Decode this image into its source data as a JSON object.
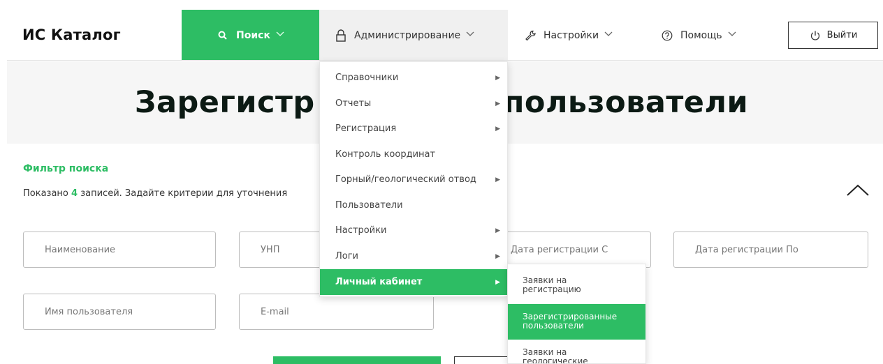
{
  "header": {
    "logo": "ИС Каталог",
    "nav": {
      "search": "Поиск",
      "admin": "Администрирование",
      "settings": "Настройки",
      "help": "Помощь"
    },
    "logout": "Выйти"
  },
  "page": {
    "title_left": "Зарегистр",
    "title_right": "пользователи"
  },
  "filter": {
    "title": "Фильтр поиска",
    "info_prefix": "Показано",
    "count": "4",
    "info_suffix": "записей. Задайте критерии для уточнения",
    "fields": {
      "name": "Наименование",
      "unp": "УНП",
      "date_from": "Дата регистрации С",
      "date_to": "Дата регистрации По",
      "username": "Имя пользователя",
      "email": "E-mail"
    }
  },
  "admin_menu": {
    "items": [
      "Справочники",
      "Отчеты",
      "Регистрация",
      "Контроль координат",
      "Горный/геологический отвод",
      "Пользователи",
      "Настройки",
      "Логи",
      "Личный кабинет"
    ],
    "active_index": 8
  },
  "submenu": {
    "items": [
      "Заявки на регистрацию",
      "Зарегистрированные пользователи",
      "Заявки на геологические"
    ],
    "active_index": 1
  },
  "colors": {
    "accent": "#2dbd64",
    "title": "#0c1a14",
    "hero_bg": "#f6f6f6"
  },
  "icons": [
    "search-icon",
    "lock-icon",
    "wrench-icon",
    "help-circle-icon",
    "power-icon",
    "chevron-down-icon",
    "chevron-up-icon",
    "chevron-right-icon"
  ]
}
